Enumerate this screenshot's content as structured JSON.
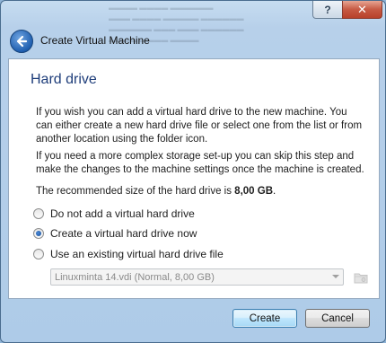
{
  "window": {
    "title": "Create Virtual Machine",
    "help_label": "?",
    "close_label": "✕"
  },
  "page": {
    "title": "Hard drive",
    "para1": "If you wish you can add a virtual hard drive to the new machine. You can either create a new hard drive file or select one from the list or from another location using the folder icon.",
    "para2": "If you need a more complex storage set-up you can skip this step and make the changes to the machine settings once the machine is created.",
    "recommended_prefix": "The recommended size of the hard drive is ",
    "recommended_size": "8,00 GB",
    "recommended_suffix": "."
  },
  "options": {
    "no_disk": "Do not add a virtual hard drive",
    "create_new": "Create a virtual hard drive now",
    "use_existing": "Use an existing virtual hard drive file",
    "selected": "create_new"
  },
  "existing_disk": {
    "value": "Linuxminta 14.vdi (Normal, 8,00 GB)"
  },
  "buttons": {
    "create": "Create",
    "cancel": "Cancel"
  },
  "colors": {
    "title_blue": "#1e3d7a",
    "frame": "#aecbe8"
  },
  "icons": {
    "back": "back-arrow-icon",
    "folder": "folder-icon",
    "dropdown": "chevron-down-icon"
  }
}
